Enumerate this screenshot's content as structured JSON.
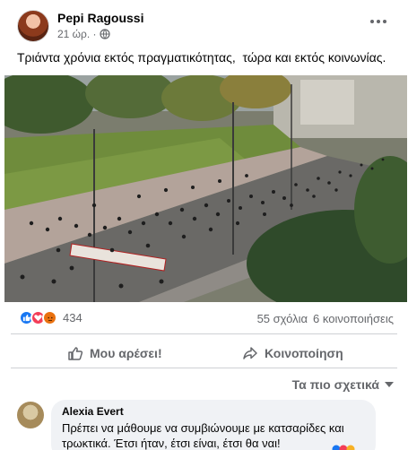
{
  "post": {
    "author": "Pepi Ragoussi",
    "time": "21 ώρ. ·",
    "text": "Τριάντα χρόνια εκτός πραγματικότητας,  τώρα και εκτός κοινωνίας."
  },
  "stats": {
    "reaction_count": "434",
    "comments": "55 σχόλια",
    "shares": "6 κοινοποιήσεις",
    "reaction_icons": [
      "like-icon",
      "love-icon",
      "angry-icon"
    ]
  },
  "actions": {
    "like_label": "Μου αρέσει!",
    "share_label": "Κοινοποίηση"
  },
  "sort": {
    "label": "Τα πιο σχετικά"
  },
  "comment": {
    "author": "Alexia Evert",
    "text": "Πρέπει να μάθουμε να συμβιώνουμε με κατσαρίδες και τρωκτικά. Έτσι ήταν, έτσι είναι, έτσι θα ναι!"
  },
  "colors": {
    "like_blue": "#1877f2",
    "love_red": "#f33e58",
    "angry_orange": "#e9710f",
    "muted_text": "#65676b"
  }
}
